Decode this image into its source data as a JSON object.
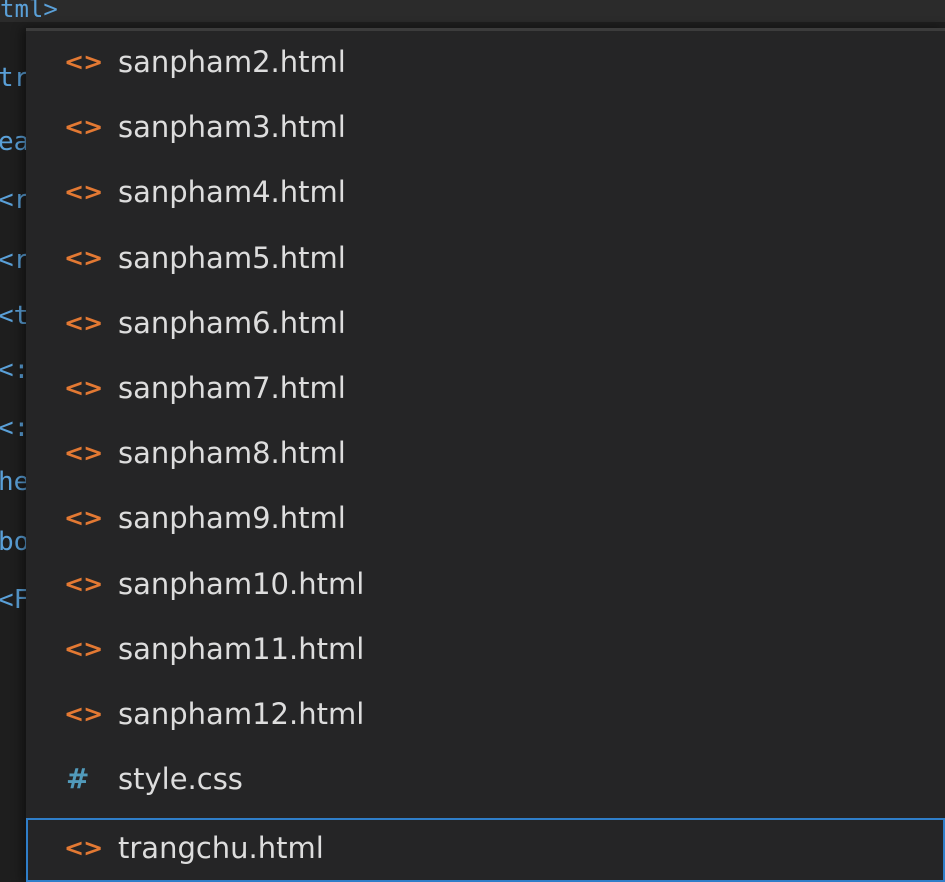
{
  "editor": {
    "top_fragment": "tml>",
    "left_fragments": [
      "tr",
      "ea",
      "<r",
      "<r",
      "<t",
      "<:",
      "<:",
      "he",
      "bo",
      "<F"
    ]
  },
  "file_list": {
    "items": [
      {
        "label": "sanpham2.html",
        "icon": "html-file-icon",
        "glyph": "<>"
      },
      {
        "label": "sanpham3.html",
        "icon": "html-file-icon",
        "glyph": "<>"
      },
      {
        "label": "sanpham4.html",
        "icon": "html-file-icon",
        "glyph": "<>"
      },
      {
        "label": "sanpham5.html",
        "icon": "html-file-icon",
        "glyph": "<>"
      },
      {
        "label": "sanpham6.html",
        "icon": "html-file-icon",
        "glyph": "<>"
      },
      {
        "label": "sanpham7.html",
        "icon": "html-file-icon",
        "glyph": "<>"
      },
      {
        "label": "sanpham8.html",
        "icon": "html-file-icon",
        "glyph": "<>"
      },
      {
        "label": "sanpham9.html",
        "icon": "html-file-icon",
        "glyph": "<>"
      },
      {
        "label": "sanpham10.html",
        "icon": "html-file-icon",
        "glyph": "<>"
      },
      {
        "label": "sanpham11.html",
        "icon": "html-file-icon",
        "glyph": "<>"
      },
      {
        "label": "sanpham12.html",
        "icon": "html-file-icon",
        "glyph": "<>"
      },
      {
        "label": "style.css",
        "icon": "css-file-icon",
        "glyph": "#"
      },
      {
        "label": "trangchu.html",
        "icon": "html-file-icon",
        "glyph": "<>"
      }
    ],
    "selected_label": "trangchu.html"
  },
  "colors": {
    "html_icon": "#e37933",
    "css_icon": "#519aba",
    "selection_border": "#2f7ec9",
    "list_background": "#252526",
    "text": "#dddddd"
  }
}
